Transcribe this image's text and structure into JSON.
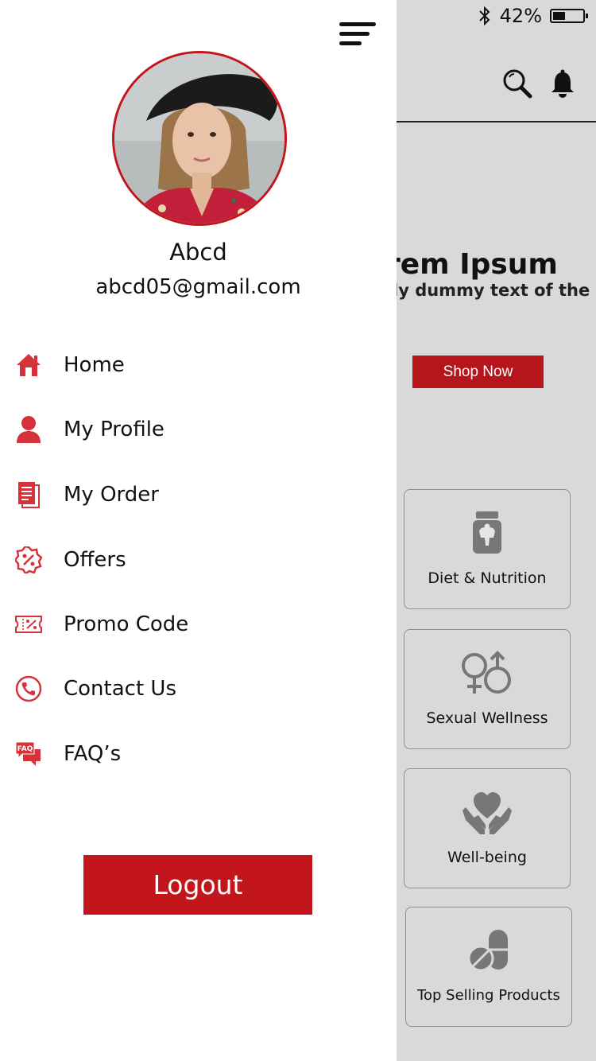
{
  "status_bar": {
    "battery_percent": "42%",
    "battery_level": 0.42
  },
  "background_page": {
    "hero_title": "rem Ipsum",
    "hero_subtitle": "ly dummy text of the",
    "shop_button": "Shop Now",
    "categories": [
      {
        "label": "Diet & Nutrition",
        "icon": "supplement-jar-icon"
      },
      {
        "label": "Sexual Wellness",
        "icon": "gender-symbols-icon"
      },
      {
        "label": "Well-being",
        "icon": "heart-in-hands-icon"
      },
      {
        "label": "Top Selling Products",
        "icon": "pills-icon"
      }
    ]
  },
  "drawer": {
    "user": {
      "name": "Abcd",
      "email": "abcd05@gmail.com"
    },
    "menu": [
      {
        "label": "Home",
        "icon": "home-icon"
      },
      {
        "label": "My Profile",
        "icon": "user-icon"
      },
      {
        "label": "My Order",
        "icon": "document-icon"
      },
      {
        "label": "Offers",
        "icon": "discount-badge-icon"
      },
      {
        "label": "Promo Code",
        "icon": "coupon-icon"
      },
      {
        "label": "Contact Us",
        "icon": "phone-icon"
      },
      {
        "label": "FAQ’s",
        "icon": "faq-chat-icon"
      }
    ],
    "logout_label": "Logout"
  },
  "colors": {
    "accent": "#c2151c",
    "background": "#d9d9d9",
    "drawer": "#ffffff"
  }
}
